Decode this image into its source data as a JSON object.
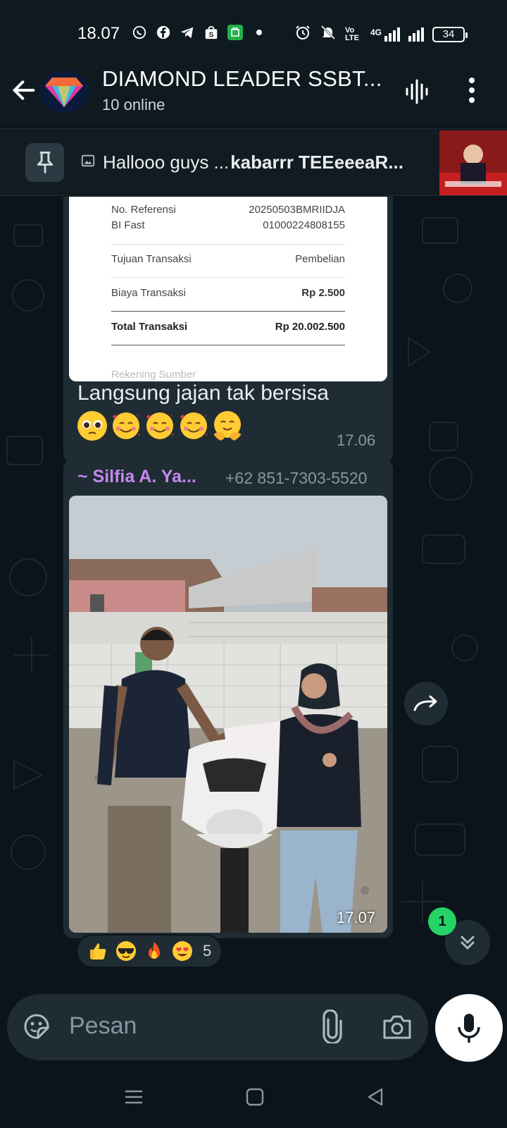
{
  "status": {
    "time": "18.07",
    "network": "4G",
    "volte": "Vo LTE",
    "battery": "34"
  },
  "header": {
    "title": "DIAMOND LEADER SSBT...",
    "subtitle": "10 online"
  },
  "pinned": {
    "text_plain": "Hallooo guys ...",
    "text_bold": "kabarrr TEEeeeaR..."
  },
  "receipt": {
    "ref_label_1": "No. Referensi",
    "ref_label_2": "BI Fast",
    "ref_value_1": "20250503BMRIIDJA",
    "ref_value_2": "01000224808155",
    "purpose_label": "Tujuan Transaksi",
    "purpose_value": "Pembelian",
    "fee_label": "Biaya Transaksi",
    "fee_value": "Rp 2.500",
    "total_label": "Total Transaksi",
    "total_value": "Rp 20.002.500",
    "cut_label": "Rekening Sumber"
  },
  "messages": {
    "first_text": "Langsung jajan tak bersisa",
    "first_time": "17.06",
    "sender_name": "~ Silfia A. Ya...",
    "sender_phone": "+62 851-7303-5520",
    "photo_time": "17.07",
    "reaction_count": "5",
    "reactions": [
      "thumbs-up",
      "sunglasses",
      "fire",
      "heart-eyes"
    ]
  },
  "unread_count": "1",
  "input": {
    "placeholder": "Pesan"
  },
  "colors": {
    "background": "#0b141a",
    "bubble": "#202c33",
    "sender": "#c38af0",
    "accent": "#25d366"
  }
}
